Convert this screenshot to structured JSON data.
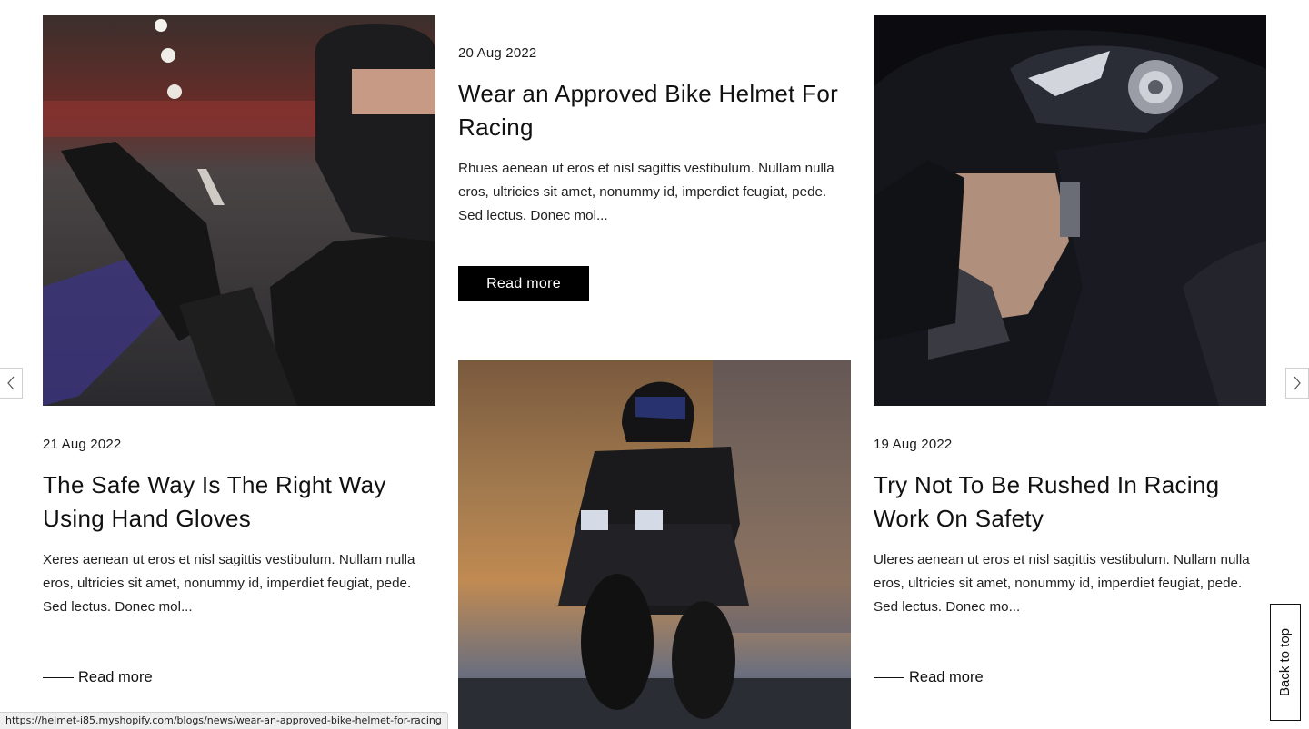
{
  "posts": [
    {
      "date": "21 Aug 2022",
      "title": "The Safe Way Is The Right Way Using Hand Gloves",
      "excerpt": "Xeres aenean ut eros et nisl sagittis vestibulum. Nullam nulla eros, ultricies sit amet, nonummy id, imperdiet feugiat, pede. Sed lectus. Donec mol...",
      "read_more": "Read more",
      "image": "woman-in-helmet-putting-on-gloves"
    },
    {
      "date": "20 Aug 2022",
      "title": "Wear an Approved Bike Helmet For Racing",
      "excerpt": "Rhues aenean ut eros et nisl sagittis vestibulum. Nullam nulla eros, ultricies sit amet, nonummy id, imperdiet feugiat, pede. Sed lectus. Donec mol...",
      "read_more": "Read more",
      "image": "rider-on-motorbike-at-sunset"
    },
    {
      "date": "19 Aug 2022",
      "title": "Try Not To Be Rushed In Racing Work On Safety",
      "excerpt": "Uleres aenean ut eros et nisl sagittis vestibulum. Nullam nulla eros, ultricies sit amet, nonummy id, imperdiet feugiat, pede. Sed lectus. Donec mo...",
      "read_more": "Read more",
      "image": "woman-in-black-helmet-profile"
    }
  ],
  "carousel": {
    "prev_icon": "chevron-left-icon",
    "next_icon": "chevron-right-icon"
  },
  "back_to_top": "Back to top",
  "status_url": "https://helmet-i85.myshopify.com/blogs/news/wear-an-approved-bike-helmet-for-racing",
  "colors": {
    "button_bg": "#000000",
    "button_text": "#ffffff",
    "text": "#111111"
  }
}
